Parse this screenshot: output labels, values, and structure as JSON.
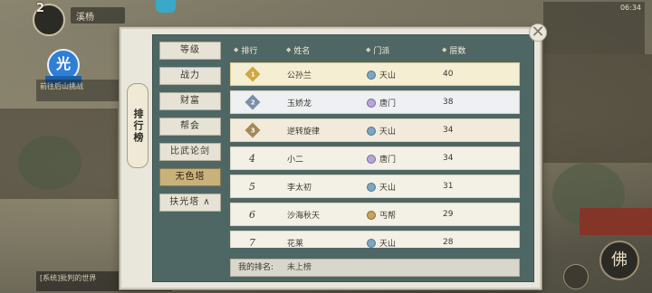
{
  "hud": {
    "level": "2",
    "player_name": "溪杨",
    "badge_char": "光",
    "side_text": "前往后山挑战",
    "chat_text": "[系统]批判的世界",
    "topright_text": "06:34",
    "buddha_char": "佛"
  },
  "panel": {
    "vertical_tab": "排行榜",
    "close_symbol": "✕"
  },
  "menu": [
    {
      "label": "等级",
      "active": false
    },
    {
      "label": "战力",
      "active": false
    },
    {
      "label": "财富",
      "active": false
    },
    {
      "label": "帮会",
      "active": false
    },
    {
      "label": "比武论剑",
      "active": false
    },
    {
      "label": "无色塔",
      "active": true
    },
    {
      "label": "扶光塔 ∧",
      "active": false
    }
  ],
  "table": {
    "headers": {
      "rank": "排行",
      "name": "姓名",
      "sect": "门派",
      "floor": "层数"
    },
    "rows": [
      {
        "rank": "1",
        "name": "公孙兰",
        "sect": "天山",
        "floor": "40"
      },
      {
        "rank": "2",
        "name": "玉娇龙",
        "sect": "唐门",
        "floor": "38"
      },
      {
        "rank": "3",
        "name": "逆转旋律",
        "sect": "天山",
        "floor": "34"
      },
      {
        "rank": "4",
        "name": "小二",
        "sect": "唐门",
        "floor": "34"
      },
      {
        "rank": "5",
        "name": "李太初",
        "sect": "天山",
        "floor": "31"
      },
      {
        "rank": "6",
        "name": "沙海秋天",
        "sect": "丐帮",
        "floor": "29"
      },
      {
        "rank": "7",
        "name": "花莱",
        "sect": "天山",
        "floor": "28"
      }
    ]
  },
  "my_rank": {
    "label": "我的排名:",
    "value": "未上榜"
  }
}
